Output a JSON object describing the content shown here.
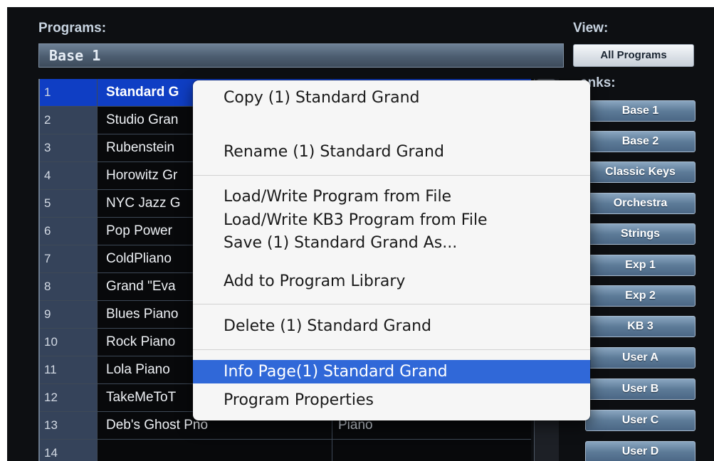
{
  "programs_label": "Programs:",
  "bank_name": "Base 1",
  "rows": [
    {
      "num": "1",
      "name": "Standard G",
      "category": "",
      "selected": true
    },
    {
      "num": "2",
      "name": "Studio Gran",
      "category": ""
    },
    {
      "num": "3",
      "name": "Rubenstein",
      "category": ""
    },
    {
      "num": "4",
      "name": "Horowitz Gr",
      "category": ""
    },
    {
      "num": "5",
      "name": "NYC Jazz G",
      "category": ""
    },
    {
      "num": "6",
      "name": "Pop Power",
      "category": ""
    },
    {
      "num": "7",
      "name": "ColdPliano",
      "category": ""
    },
    {
      "num": "8",
      "name": "Grand \"Eva",
      "category": ""
    },
    {
      "num": "9",
      "name": "Blues Piano",
      "category": ""
    },
    {
      "num": "10",
      "name": "Rock Piano",
      "category": ""
    },
    {
      "num": "11",
      "name": "Lola Piano",
      "category": ""
    },
    {
      "num": "12",
      "name": "TakeMeToT",
      "category": ""
    },
    {
      "num": "13",
      "name": "Deb's  Ghost Pno",
      "category": "Piano"
    },
    {
      "num": "14",
      "name": "",
      "category": ""
    }
  ],
  "view": {
    "label": "View:",
    "button": "All Programs"
  },
  "banks": {
    "label": "anks:",
    "items": [
      "Base 1",
      "Base 2",
      "Classic Keys",
      "Orchestra",
      "Strings",
      "Exp 1",
      "Exp 2",
      "KB 3",
      "User A",
      "User B",
      "User C",
      "User D"
    ]
  },
  "context_menu": {
    "items": [
      "Copy (1)  Standard Grand",
      "Rename (1)  Standard Grand",
      "Load/Write Program from File",
      "Load/Write KB3 Program from File",
      "Save  (1)  Standard Grand As...",
      "Add to Program Library",
      "Delete (1)  Standard Grand",
      "Info Page(1)  Standard Grand",
      "Program Properties"
    ],
    "highlighted_index": 7
  },
  "colors": {
    "panel_bg": "#0d0f12",
    "selected_row": "#0f3ec4",
    "menu_highlight": "#3068d8",
    "bank_button": "#5d7b98"
  }
}
